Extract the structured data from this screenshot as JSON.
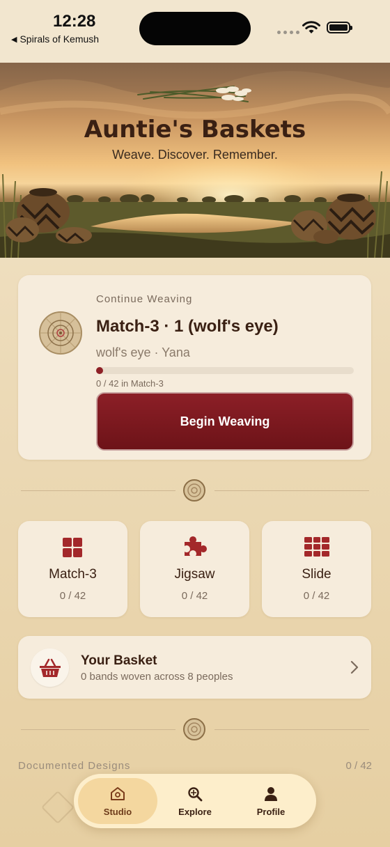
{
  "status_bar": {
    "time": "12:28",
    "back_app": "Spirals of Kemush"
  },
  "hero": {
    "title": "Auntie's Baskets",
    "tagline": "Weave. Discover. Remember."
  },
  "continue_card": {
    "eyebrow": "Continue Weaving",
    "game_title": "Match-3 · 1 (wolf's eye)",
    "meta": "wolf's eye · Yana",
    "progress_fraction": 0,
    "progress_text": "0 / 42 in Match-3",
    "button_label": "Begin Weaving"
  },
  "modes": [
    {
      "label": "Match-3",
      "count": "0 / 42",
      "icon": "grid-2x2-icon"
    },
    {
      "label": "Jigsaw",
      "count": "0 / 42",
      "icon": "puzzle-icon"
    },
    {
      "label": "Slide",
      "count": "0 / 42",
      "icon": "grid-3x3-icon"
    }
  ],
  "basket": {
    "title": "Your Basket",
    "subtitle": "0 bands woven across 8 peoples"
  },
  "documented": {
    "label": "Documented Designs",
    "count": "0 / 42"
  },
  "tabs": [
    {
      "label": "Studio",
      "icon": "studio-house-icon",
      "active": true
    },
    {
      "label": "Explore",
      "icon": "explore-magnifier-icon",
      "active": false
    },
    {
      "label": "Profile",
      "icon": "profile-person-icon",
      "active": false
    }
  ],
  "colors": {
    "accent": "#8c1f27",
    "icon_red": "#a3282a",
    "background": "#ecdab7",
    "card": "#f6ecdc"
  }
}
